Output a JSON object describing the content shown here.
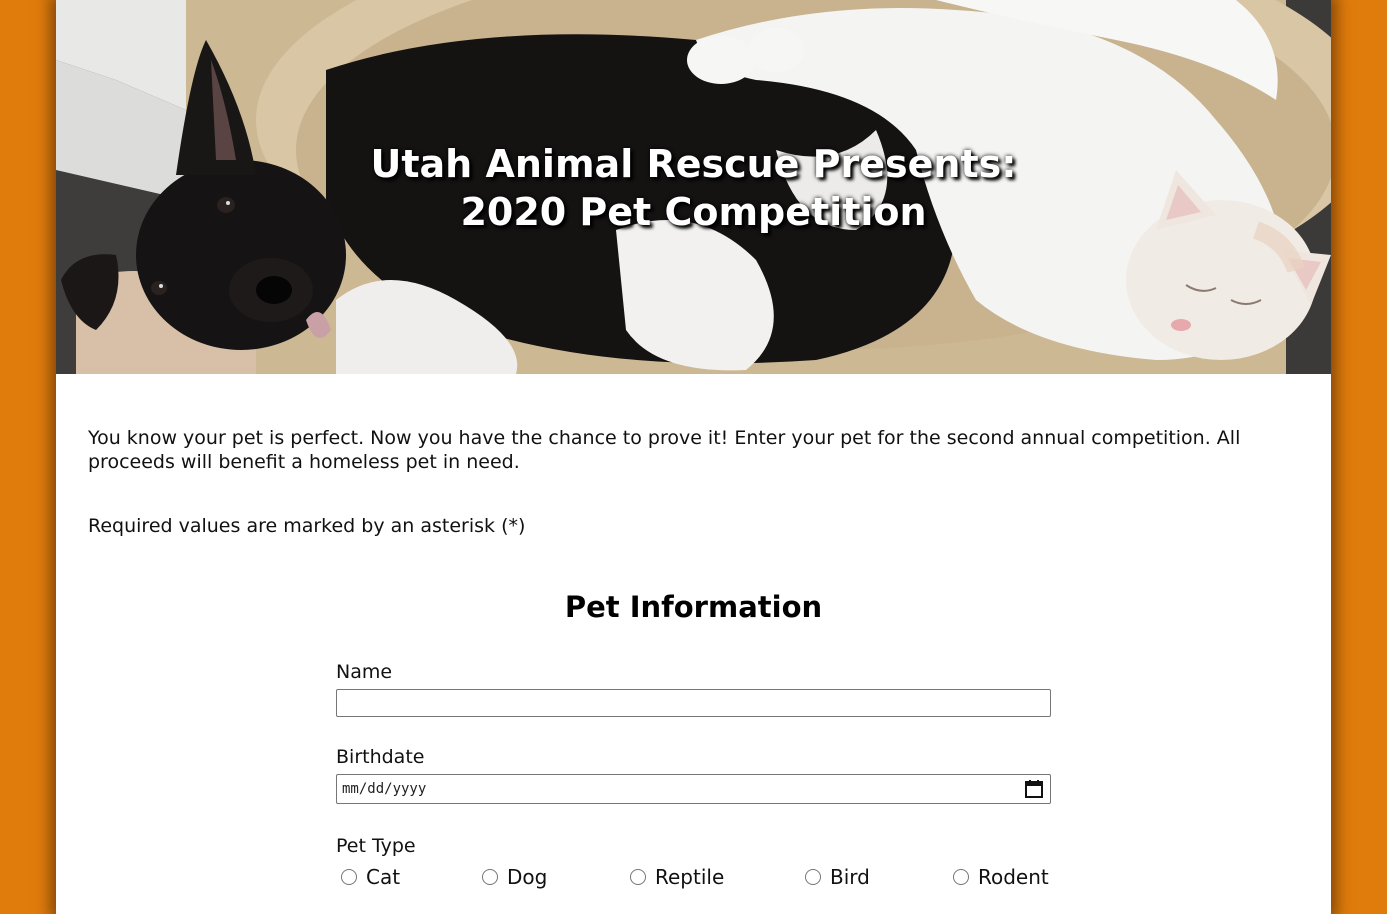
{
  "hero": {
    "title_line1": "Utah Animal Rescue Presents:",
    "title_line2": "2020 Pet Competition",
    "image_subject": "black and white dog lying next to a white cat on a beige pet bed"
  },
  "intro_text": "You know your pet is perfect. Now you have the chance to prove it! Enter your pet for the second annual competition. All proceeds will benefit a homeless pet in need.",
  "required_note": "Required values are marked by an asterisk (*)",
  "section": {
    "title": "Pet Information"
  },
  "form": {
    "name": {
      "label": "Name",
      "value": ""
    },
    "birthdate": {
      "label": "Birthdate",
      "placeholder": "mm/dd/yyyy",
      "icon": "calendar-icon"
    },
    "pet_type": {
      "label": "Pet Type",
      "options": [
        {
          "label": "Cat",
          "checked": false
        },
        {
          "label": "Dog",
          "checked": false
        },
        {
          "label": "Reptile",
          "checked": false
        },
        {
          "label": "Bird",
          "checked": false
        },
        {
          "label": "Rodent",
          "checked": false
        }
      ]
    }
  },
  "colors": {
    "page_background": "#e07c0c",
    "card_background": "#ffffff",
    "title_text": "#ffffff"
  }
}
